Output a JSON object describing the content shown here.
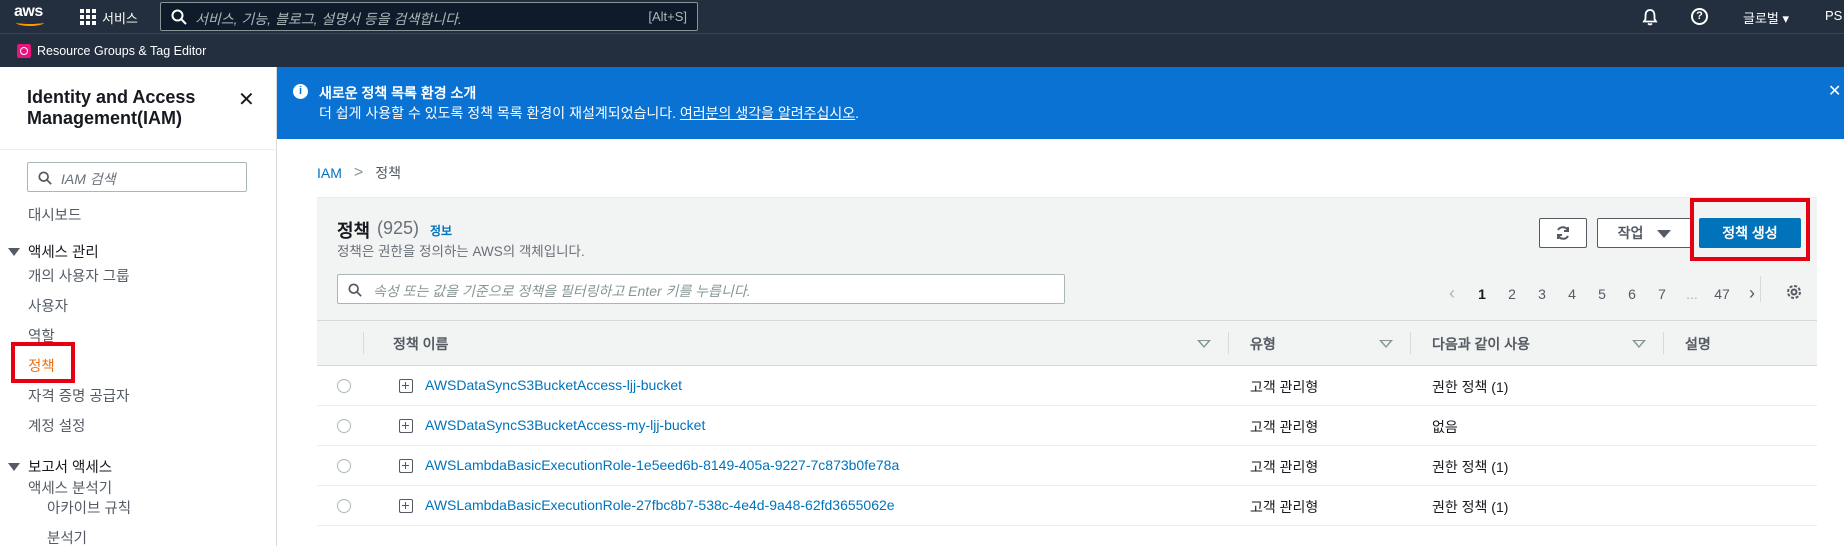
{
  "topnav": {
    "logo": "aws",
    "services_label": "서비스",
    "search_placeholder": "서비스, 기능, 블로그, 설명서 등을 검색합니다.",
    "search_shortcut": "[Alt+S]",
    "region_label": "글로벌 ▾",
    "account_label": "PS",
    "icons": [
      "grid-icon",
      "search-icon",
      "bell-icon",
      "help-icon"
    ]
  },
  "subbar": {
    "resource_groups_label": "Resource Groups & Tag Editor"
  },
  "sidebar": {
    "title": "Identity and Access Management(IAM)",
    "search_placeholder": "IAM 검색",
    "dashboard": "대시보드",
    "access_management": {
      "header": "액세스 관리",
      "items": [
        "개의 사용자 그룹",
        "사용자",
        "역할",
        "정책",
        "자격 증명 공급자",
        "계정 설정"
      ],
      "active": "정책"
    },
    "access_reports": {
      "header": "보고서 액세스",
      "items": [
        "액세스 분석기",
        "아카이브 규칙",
        "분석기"
      ]
    }
  },
  "banner": {
    "title": "새로운 정책 목록 환경 소개",
    "body": "더 쉽게 사용할 수 있도록 정책 목록 환경이 재설계되었습니다.",
    "link": "여러분의 생각을 알려주십시오",
    "link_suffix": "."
  },
  "breadcrumb": {
    "root": "IAM",
    "separator": ">",
    "current": "정책"
  },
  "policies": {
    "title": "정책",
    "count": "(925)",
    "info": "정보",
    "description": "정책은 권한을 정의하는 AWS의 객체입니다.",
    "actions_label": "작업",
    "create_label": "정책 생성",
    "filter_placeholder": "속성 또는 값을 기준으로 정책을 필터링하고 Enter 키를 누릅니다.",
    "pagination": {
      "pages": [
        "1",
        "2",
        "3",
        "4",
        "5",
        "6",
        "7",
        "...",
        "47"
      ],
      "current": "1"
    },
    "columns": [
      "정책 이름",
      "유형",
      "다음과 같이 사용",
      "설명"
    ],
    "rows": [
      {
        "name": "AWSDataSyncS3BucketAccess-ljj-bucket",
        "type": "고객 관리형",
        "used_as": "권한 정책 (1)",
        "desc": ""
      },
      {
        "name": "AWSDataSyncS3BucketAccess-my-ljj-bucket",
        "type": "고객 관리형",
        "used_as": "없음",
        "desc": ""
      },
      {
        "name": "AWSLambdaBasicExecutionRole-1e5eed6b-8149-405a-9227-7c873b0fe78a",
        "type": "고객 관리형",
        "used_as": "권한 정책 (1)",
        "desc": ""
      },
      {
        "name": "AWSLambdaBasicExecutionRole-27fbc8b7-538c-4e4d-9a48-62fd3655062e",
        "type": "고객 관리형",
        "used_as": "권한 정책 (1)",
        "desc": ""
      }
    ]
  },
  "colors": {
    "nav_bg": "#232f3e",
    "banner_bg": "#0972d3",
    "link": "#0073bb",
    "primary_button": "#0073bb",
    "active_nav": "#ec7211",
    "highlight_box": "#e60012",
    "aws_orange": "#ff9900"
  }
}
